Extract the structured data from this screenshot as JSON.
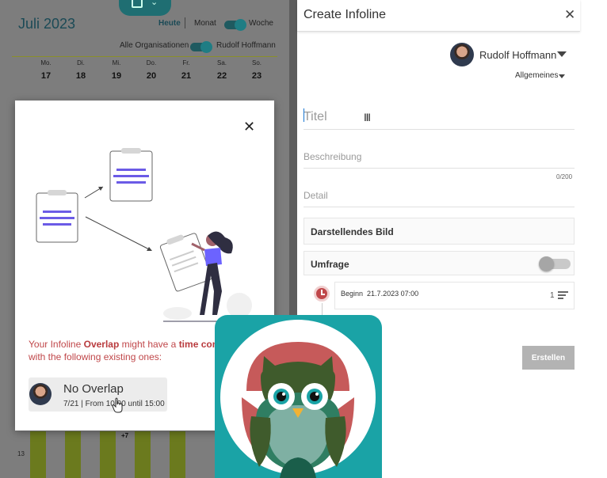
{
  "calendar": {
    "title": "Juli 2023",
    "today": "Heute",
    "month": "Monat",
    "week": "Woche",
    "all_orgs": "Alle Organisationen",
    "user": "Rudolf Hoffmann",
    "days": [
      {
        "name": "Mo.",
        "date": "17"
      },
      {
        "name": "Di.",
        "date": "18"
      },
      {
        "name": "Mi.",
        "date": "19"
      },
      {
        "name": "Do.",
        "date": "20"
      },
      {
        "name": "Fr.",
        "date": "21"
      },
      {
        "name": "Sa.",
        "date": "22"
      },
      {
        "name": "So.",
        "date": "23"
      }
    ],
    "more_count": "+7",
    "hour_label": "13"
  },
  "dialog": {
    "message_pre": "Your Infoline ",
    "message_name": "Overlap",
    "message_mid": " might have a ",
    "message_conflict": "time confl",
    "message_post": "with the following existing ones:",
    "overlap_title": "No Overlap",
    "overlap_subtitle": "7/21 | From 10:00 until 15:00"
  },
  "panel": {
    "title": "Create Infoline",
    "user": "Rudolf Hoffmann",
    "category": "Allgemeines",
    "title_placeholder": "Titel",
    "description_placeholder": "Beschreibung",
    "counter": "0/200",
    "detail_placeholder": "Detail",
    "image_section": "Darstellendes Bild",
    "survey_section": "Umfrage",
    "begin_label": "Beginn",
    "begin_value": "21.7.2023 07:00",
    "begin_count": "1",
    "create_button": "Erstellen"
  },
  "colors": {
    "accent": "#1f6e72",
    "warning": "#c0474a",
    "logo_bg": "#1aa3a6"
  }
}
